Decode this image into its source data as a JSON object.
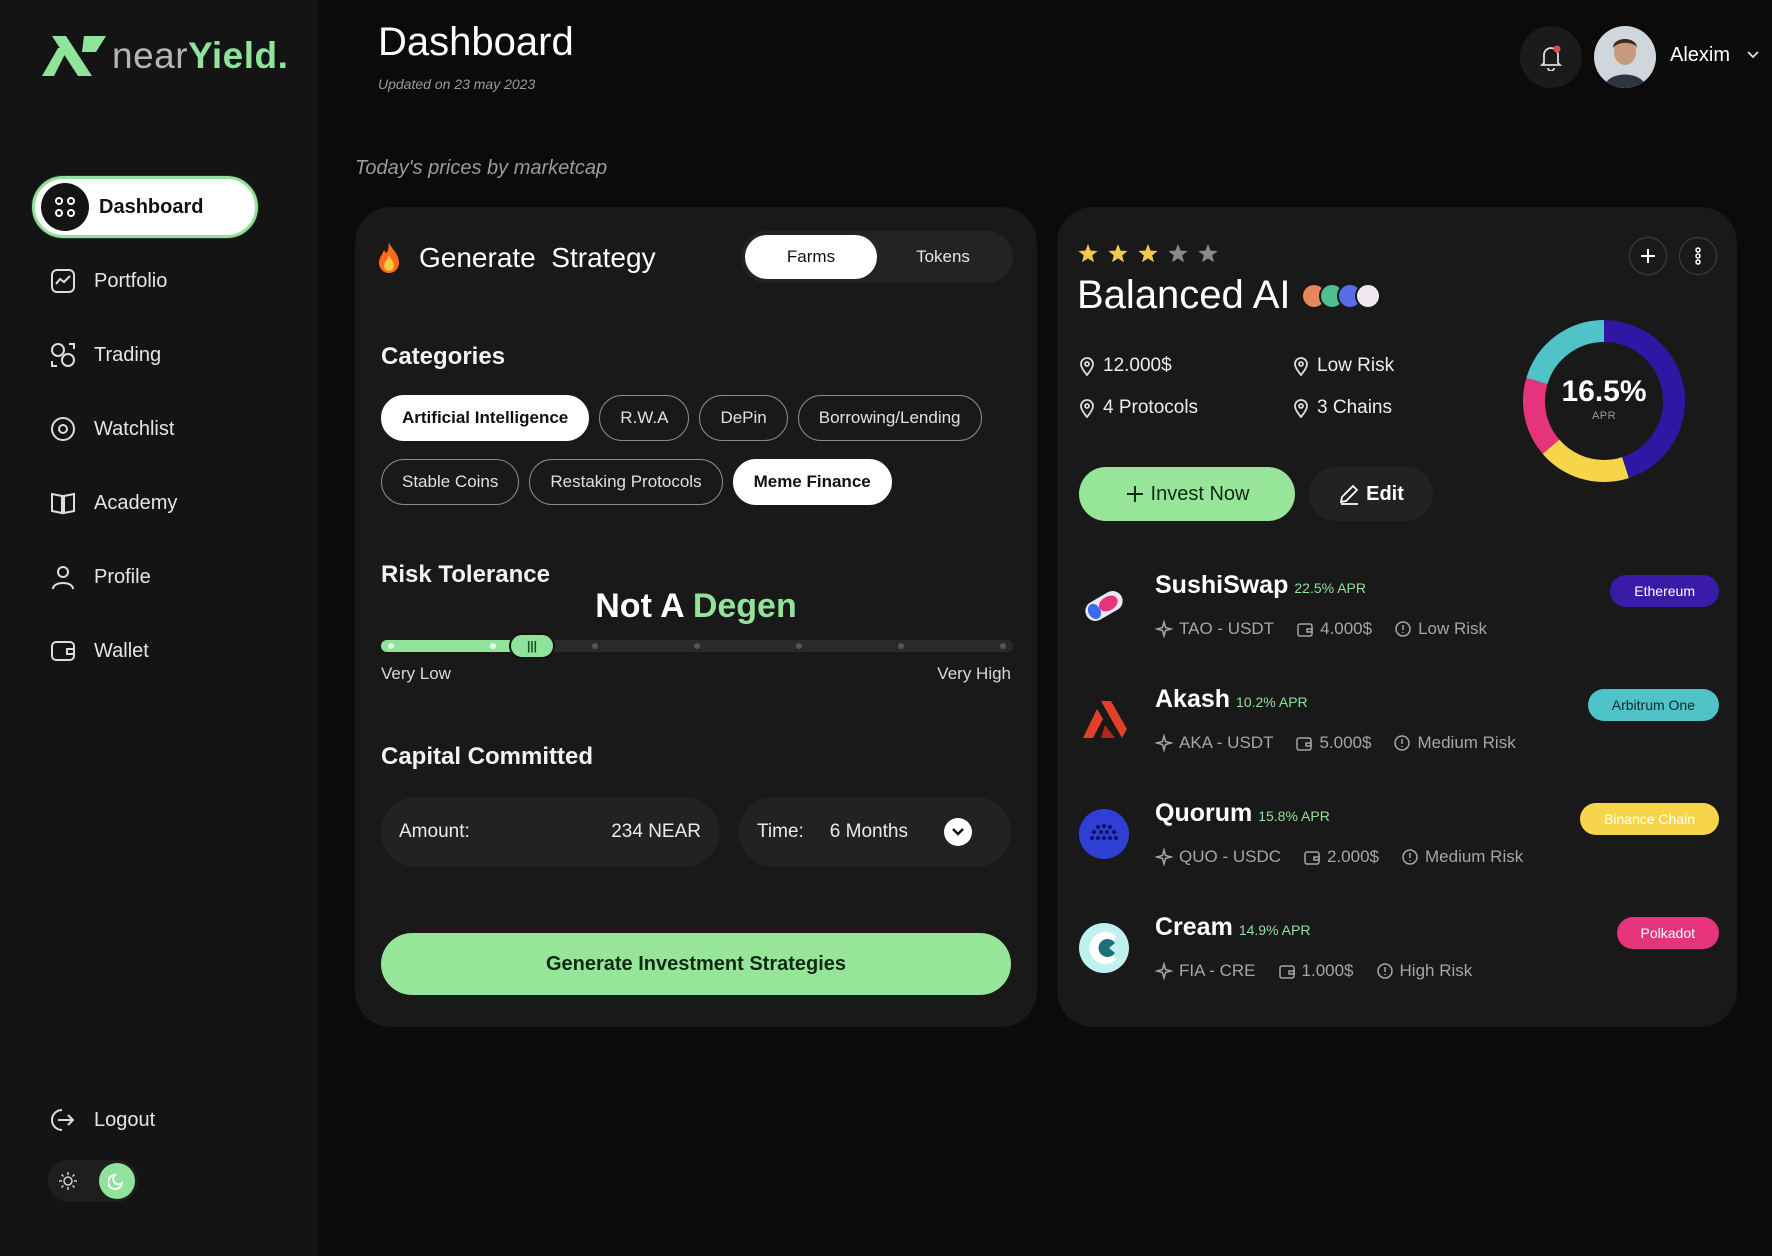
{
  "brand": {
    "near": "near",
    "yield": "Yield."
  },
  "nav": {
    "items": [
      {
        "label": "Dashboard",
        "icon": "grid-icon",
        "active": true
      },
      {
        "label": "Portfolio",
        "icon": "chart-icon"
      },
      {
        "label": "Trading",
        "icon": "trading-icon"
      },
      {
        "label": "Watchlist",
        "icon": "eye-icon"
      },
      {
        "label": "Academy",
        "icon": "book-icon"
      },
      {
        "label": "Profile",
        "icon": "user-icon"
      },
      {
        "label": "Wallet",
        "icon": "wallet-icon"
      }
    ],
    "logout": "Logout"
  },
  "header": {
    "title": "Dashboard",
    "updated": "Updated on 23 may 2023",
    "user": "Alexim"
  },
  "subtitle": "Today's prices by marketcap",
  "strategy": {
    "title": "Generate  Strategy",
    "tabs": [
      "Farms",
      "Tokens"
    ],
    "active_tab": "Farms",
    "categories_title": "Categories",
    "categories": [
      {
        "label": "Artificial Intelligence",
        "selected": true
      },
      {
        "label": "R.W.A",
        "selected": false
      },
      {
        "label": "DePin",
        "selected": false
      },
      {
        "label": "Borrowing/Lending",
        "selected": false
      },
      {
        "label": "Stable Coins",
        "selected": false
      },
      {
        "label": "Restaking Protocols",
        "selected": false
      },
      {
        "label": "Meme Finance",
        "selected": true
      }
    ],
    "risk_title": "Risk Tolerance",
    "risk_value_a": "Not A ",
    "risk_value_b": "Degen",
    "risk_level": 0.2,
    "risk_min": "Very Low",
    "risk_max": "Very High",
    "capital_title": "Capital Committed",
    "amount_label": "Amount:",
    "amount_value": "234 NEAR",
    "time_label": "Time:",
    "time_value": "6 Months",
    "generate_label": "Generate Investment Strategies"
  },
  "ai": {
    "rating": 3,
    "rating_max": 5,
    "title": "Balanced AI",
    "stats": {
      "amount": "12.000$",
      "risk": "Low Risk",
      "protocols": "4 Protocols",
      "chains": "3 Chains"
    },
    "apr_value": "16.5%",
    "apr_label": "APR",
    "invest_label": "Invest Now",
    "edit_label": "Edit",
    "protocols": [
      {
        "name": "SushiSwap",
        "apr": "22.5% APR",
        "pair": "TAO - USDT",
        "amount": "4.000$",
        "risk": "Low Risk",
        "chain": "Ethereum",
        "chain_color": "#3a1aa8",
        "chain_text": "#ffffff",
        "logo": "sushi-logo-icon"
      },
      {
        "name": "Akash",
        "apr": "10.2% APR",
        "pair": "AKA - USDT",
        "amount": "5.000$",
        "risk": "Medium Risk",
        "chain": "Arbitrum One",
        "chain_color": "#4fc3c8",
        "chain_text": "#0b2d30",
        "logo": "akash-logo-icon"
      },
      {
        "name": "Quorum",
        "apr": "15.8% APR",
        "pair": "QUO - USDC",
        "amount": "2.000$",
        "risk": "Medium Risk",
        "chain": "Binance Chain",
        "chain_color": "#f7d54a",
        "chain_text": "#ffffff",
        "logo": "quorum-logo-icon"
      },
      {
        "name": "Cream",
        "apr": "14.9% APR",
        "pair": "FIA - CRE",
        "amount": "1.000$",
        "risk": "High Risk",
        "chain": "Polkadot",
        "chain_color": "#e5347c",
        "chain_text": "#ffffff",
        "logo": "cream-logo-icon"
      }
    ]
  }
}
